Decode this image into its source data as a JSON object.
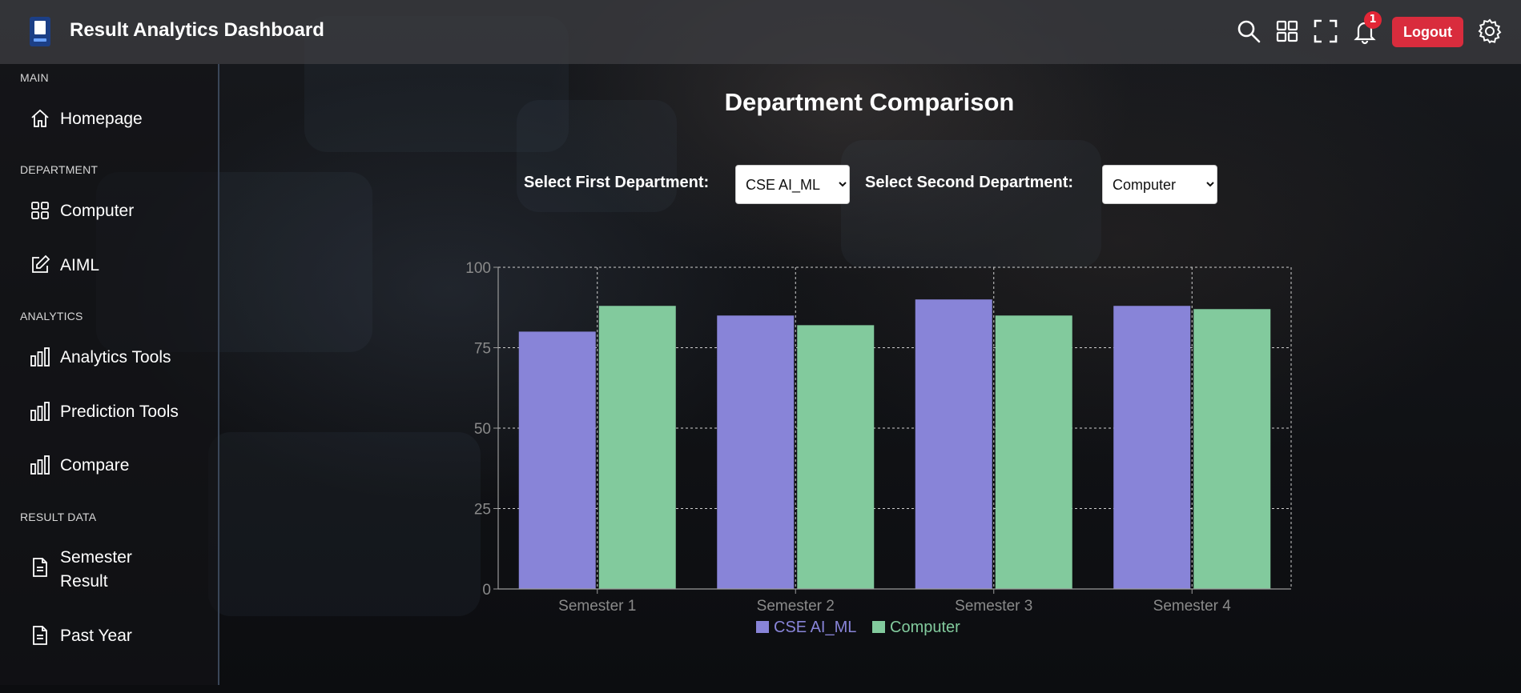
{
  "app": {
    "title": "Result Analytics Dashboard",
    "notification_count": "1",
    "logout_label": "Logout"
  },
  "sidebar": {
    "sections": [
      {
        "label": "MAIN"
      },
      {
        "label": "DEPARTMENT"
      },
      {
        "label": "ANALYTICS"
      },
      {
        "label": "RESULT DATA"
      }
    ],
    "items": [
      {
        "label": "Homepage",
        "icon": "home-icon"
      },
      {
        "label": "Computer",
        "icon": "grid-icon"
      },
      {
        "label": "AIML",
        "icon": "edit-icon"
      },
      {
        "label": "Analytics Tools",
        "icon": "bar-chart-icon"
      },
      {
        "label": "Prediction Tools",
        "icon": "bar-chart-icon"
      },
      {
        "label": "Compare",
        "icon": "bar-chart-icon"
      },
      {
        "label": "Semester Result",
        "icon": "document-icon"
      },
      {
        "label": "Past Year",
        "icon": "document-icon"
      }
    ]
  },
  "main": {
    "title": "Department Comparison",
    "first_department": {
      "label": "Select First Department:",
      "value": "CSE AI_ML"
    },
    "second_department": {
      "label": "Select Second Department:",
      "value": "Computer"
    }
  },
  "chart_data": {
    "type": "bar",
    "categories": [
      "Semester 1",
      "Semester 2",
      "Semester 3",
      "Semester 4"
    ],
    "series": [
      {
        "name": "CSE AI_ML",
        "values": [
          80,
          85,
          90,
          88
        ],
        "color": "#8884d8"
      },
      {
        "name": "Computer",
        "values": [
          88,
          82,
          85,
          87
        ],
        "color": "#82ca9d"
      }
    ],
    "yticks": [
      0,
      25,
      50,
      75,
      100
    ],
    "ylim": [
      0,
      100
    ],
    "grid": true,
    "legend": "bottom"
  }
}
